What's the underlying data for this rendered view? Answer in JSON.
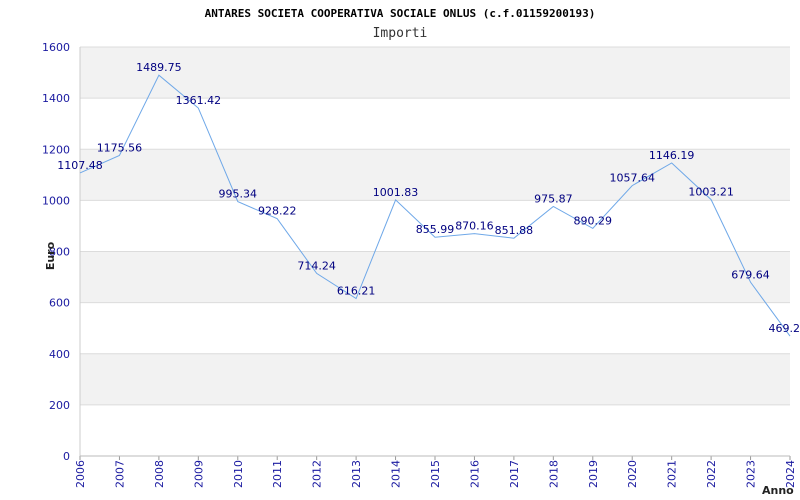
{
  "chart_data": {
    "type": "line",
    "title": "ANTARES SOCIETA COOPERATIVA SOCIALE ONLUS (c.f.01159200193)",
    "subtitle": "Importi",
    "xlabel": "Anno",
    "ylabel": "Euro",
    "x": [
      "2006",
      "2007",
      "2008",
      "2009",
      "2010",
      "2011",
      "2012",
      "2013",
      "2014",
      "2015",
      "2016",
      "2017",
      "2018",
      "2019",
      "2020",
      "2021",
      "2022",
      "2023",
      "2024"
    ],
    "values": [
      1107.48,
      1175.56,
      1489.75,
      1361.42,
      995.34,
      928.22,
      714.24,
      616.21,
      1001.83,
      855.99,
      870.16,
      851.88,
      975.87,
      890.29,
      1057.64,
      1146.19,
      1003.21,
      679.64,
      469.2
    ],
    "value_labels": [
      "1107.48",
      "1175.56",
      "1489.75",
      "1361.42",
      "995.34",
      "928.22",
      "714.24",
      "616.21",
      "1001.83",
      "855.99",
      "870.16",
      "851.88",
      "975.87",
      "890.29",
      "1057.64",
      "1146.19",
      "1003.21",
      "679.64",
      "469.2"
    ],
    "ylim": [
      0,
      1600
    ],
    "yticks": [
      "0",
      "200",
      "400",
      "600",
      "800",
      "1000",
      "1200",
      "1400",
      "1600"
    ],
    "grid": true,
    "band_colors": [
      "#ffffff",
      "#f2f2f2"
    ],
    "line_color": "#6fa8e8",
    "tick_color": "#1a1aa0",
    "label_color": "#000080"
  }
}
